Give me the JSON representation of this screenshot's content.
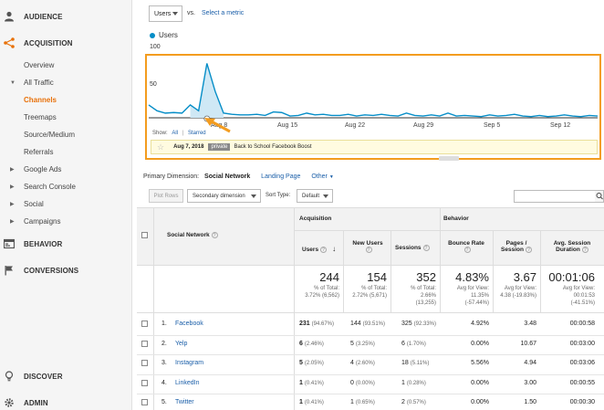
{
  "sidebar": {
    "top_items": [
      {
        "label": "AUDIENCE",
        "icon": "person-icon"
      },
      {
        "label": "ACQUISITION",
        "icon": "acquisition-icon"
      },
      {
        "label": "BEHAVIOR",
        "icon": "behavior-icon"
      },
      {
        "label": "CONVERSIONS",
        "icon": "flag-icon"
      },
      {
        "label": "DISCOVER",
        "icon": "lightbulb-icon"
      },
      {
        "label": "ADMIN",
        "icon": "gear-icon"
      }
    ],
    "sub_items": [
      {
        "label": "Overview"
      },
      {
        "label": "All Traffic"
      },
      {
        "label": "Channels"
      },
      {
        "label": "Treemaps"
      },
      {
        "label": "Source/Medium"
      },
      {
        "label": "Referrals"
      },
      {
        "label": "Google Ads"
      },
      {
        "label": "Search Console"
      },
      {
        "label": "Social"
      },
      {
        "label": "Campaigns"
      }
    ],
    "accent_color": "#e8710a"
  },
  "controls": {
    "metric_select": "Users",
    "vs": "vs.",
    "select_metric": "Select a metric"
  },
  "chart_data": {
    "type": "line",
    "series": [
      {
        "name": "Users",
        "color": "#058dc7",
        "values": [
          22,
          12,
          8,
          9,
          8,
          22,
          12,
          93,
          45,
          8,
          6,
          5,
          5,
          6,
          4,
          10,
          9,
          3,
          4,
          8,
          5,
          6,
          4,
          4,
          6,
          3,
          5,
          4,
          6,
          4,
          3,
          8,
          4,
          3,
          5,
          3,
          8,
          3,
          4,
          3,
          2,
          5,
          3,
          4,
          6,
          3,
          2,
          4,
          2,
          3,
          5,
          3,
          2,
          4,
          3
        ]
      }
    ],
    "x_ticks": [
      "Aug 8",
      "Aug 15",
      "Aug 22",
      "Aug 29",
      "Sep 5",
      "Sep 12"
    ],
    "y_ticks": [
      "100",
      "50"
    ],
    "ylim": [
      0,
      100
    ],
    "annotation": {
      "show_label": "Show:",
      "all": "All",
      "starred": "Starred",
      "date": "Aug 7, 2018",
      "tag": "private",
      "text": "Back to School Facebook Boost"
    }
  },
  "dimension": {
    "label": "Primary Dimension:",
    "active": "Social Network",
    "option1": "Landing Page",
    "other": "Other"
  },
  "toolbar": {
    "plot_rows": "Plot Rows",
    "secondary": "Secondary dimension",
    "sort_type_label": "Sort Type:",
    "sort_type": "Default"
  },
  "table": {
    "col_social": "Social Network",
    "group_acq": "Acquisition",
    "group_beh": "Behavior",
    "col_users": "Users",
    "col_new_users": "New Users",
    "col_sessions": "Sessions",
    "col_bounce": "Bounce Rate",
    "col_pages": "Pages / Session",
    "col_duration": "Avg. Session Duration",
    "totals": {
      "users": "244",
      "users_sub1": "% of Total:",
      "users_sub2": "3.72% (6,562)",
      "new_users": "154",
      "new_users_sub1": "% of Total:",
      "new_users_sub2": "2.72% (5,671)",
      "sessions": "352",
      "sessions_sub1": "% of Total:",
      "sessions_sub2": "2.66%",
      "sessions_sub3": "(13,255)",
      "bounce": "4.83%",
      "bounce_sub1": "Avg for View:",
      "bounce_sub2": "11.35%",
      "bounce_sub3": "(-57.44%)",
      "pages": "3.67",
      "pages_sub1": "Avg for View:",
      "pages_sub2": "4.38 (-19.83%)",
      "duration": "00:01:06",
      "duration_sub1": "Avg for View:",
      "duration_sub2": "00:01:53",
      "duration_sub3": "(-41.51%)"
    },
    "rows": [
      {
        "idx": "1.",
        "name": "Facebook",
        "users": "231",
        "users_pct": "(94.67%)",
        "new": "144",
        "new_pct": "(93.51%)",
        "sessions": "325",
        "sessions_pct": "(92.33%)",
        "bounce": "4.92%",
        "pages": "3.48",
        "duration": "00:00:58"
      },
      {
        "idx": "2.",
        "name": "Yelp",
        "users": "6",
        "users_pct": "(2.46%)",
        "new": "5",
        "new_pct": "(3.25%)",
        "sessions": "6",
        "sessions_pct": "(1.70%)",
        "bounce": "0.00%",
        "pages": "10.67",
        "duration": "00:03:00"
      },
      {
        "idx": "3.",
        "name": "Instagram",
        "users": "5",
        "users_pct": "(2.05%)",
        "new": "4",
        "new_pct": "(2.60%)",
        "sessions": "18",
        "sessions_pct": "(5.11%)",
        "bounce": "5.56%",
        "pages": "4.94",
        "duration": "00:03:06"
      },
      {
        "idx": "4.",
        "name": "LinkedIn",
        "users": "1",
        "users_pct": "(0.41%)",
        "new": "0",
        "new_pct": "(0.00%)",
        "sessions": "1",
        "sessions_pct": "(0.28%)",
        "bounce": "0.00%",
        "pages": "3.00",
        "duration": "00:00:55"
      },
      {
        "idx": "5.",
        "name": "Twitter",
        "users": "1",
        "users_pct": "(0.41%)",
        "new": "1",
        "new_pct": "(0.65%)",
        "sessions": "2",
        "sessions_pct": "(0.57%)",
        "bounce": "0.00%",
        "pages": "1.50",
        "duration": "00:00:30"
      }
    ]
  }
}
